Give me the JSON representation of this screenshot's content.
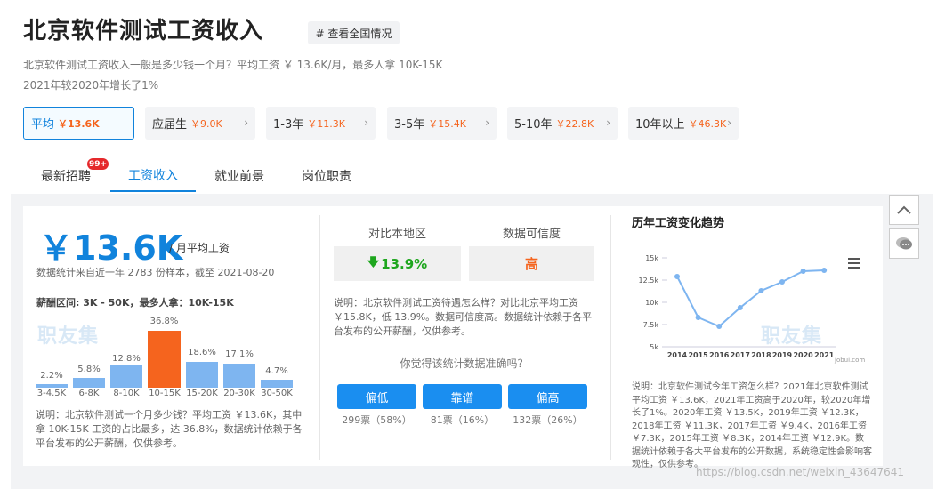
{
  "header": {
    "title": "北京软件测试工资收入",
    "tag_button": "# 查看全国情况",
    "desc_line1": "北京软件测试工资收入一般是多少钱一个月？平均工资 ￥ 13.6K/月，最多人拿 10K-15K",
    "desc_line2": "2021年较2020年增长了1%"
  },
  "levels": [
    {
      "label": "平均",
      "value": "￥13.6K",
      "active": true
    },
    {
      "label": "应届生",
      "value": "￥9.0K",
      "active": false
    },
    {
      "label": "1-3年",
      "value": "￥11.3K",
      "active": false
    },
    {
      "label": "3-5年",
      "value": "￥15.4K",
      "active": false
    },
    {
      "label": "5-10年",
      "value": "￥22.8K",
      "active": false
    },
    {
      "label": "10年以上",
      "value": "￥46.3K",
      "active": false
    }
  ],
  "tabs": [
    {
      "label": "最新招聘",
      "badge": "99+"
    },
    {
      "label": "工资收入",
      "active": true
    },
    {
      "label": "就业前景"
    },
    {
      "label": "岗位职责"
    }
  ],
  "salary": {
    "big": "￥13.6K",
    "suffix": "/ 月平均工资",
    "sample_note": "数据统计来自近一年 2783 份样本，截至 2021-08-20",
    "range_note": "薪酬区间: 3K - 50K，最多人拿：10K-15K",
    "watermark": "职友集",
    "explain": "说明：北京软件测试一个月多少钱？平均工资 ￥13.6K，其中拿 10K-15K 工资的占比最多，达 36.8%，数据统计依赖于各平台发布的公开薪酬，仅供参考。"
  },
  "dist": [
    {
      "range": "3-4.5K",
      "pct": "2.2%",
      "value": 2.2
    },
    {
      "range": "6-8K",
      "pct": "5.8%",
      "value": 5.8
    },
    {
      "range": "8-10K",
      "pct": "12.8%",
      "value": 12.8
    },
    {
      "range": "10-15K",
      "pct": "36.8%",
      "value": 36.8,
      "highlight": true
    },
    {
      "range": "15-20K",
      "pct": "18.6%",
      "value": 18.6
    },
    {
      "range": "20-30K",
      "pct": "17.1%",
      "value": 17.1
    },
    {
      "range": "30-50K",
      "pct": "4.7%",
      "value": 4.7
    }
  ],
  "compare": {
    "h1": "对比本地区",
    "h2": "数据可信度",
    "v1": "13.9%",
    "v1_arrow": "🡇",
    "v2": "高",
    "note": "说明：北京软件测试工资待遇怎么样？对比北京平均工资 ￥15.8K，低 13.9%。数据可信度高。数据统计依赖于各平台发布的公开薪酬，仅供参考。",
    "question": "你觉得该统计数据准确吗？",
    "votes": [
      {
        "label": "偏低",
        "count": "299票（58%）"
      },
      {
        "label": "靠谱",
        "count": "81票（16%）"
      },
      {
        "label": "偏高",
        "count": "132票（26%）"
      }
    ]
  },
  "trend": {
    "title": "历年工资变化趋势",
    "menu_icon": "menu-icon",
    "site": "jobui.com",
    "watermark": "职友集",
    "note": "说明：北京软件测试今年工资怎么样？2021年北京软件测试平均工资 ￥13.6K，2021年工资高于2020年，较2020年增长了1%。2020年工资 ￥13.5K，2019年工资 ￥12.3K，2018年工资 ￥11.3K，2017年工资 ￥9.4K，2016年工资 ￥7.3K，2015年工资 ￥8.3K，2014年工资 ￥12.9K。数据统计依赖于各大平台发布的公开数据，系统稳定性会影响客观性，仅供参考。"
  },
  "chart_data": {
    "type": "line",
    "x": [
      "2014",
      "2015",
      "2016",
      "2017",
      "2018",
      "2019",
      "2020",
      "2021"
    ],
    "values": [
      12.9,
      8.3,
      7.3,
      9.4,
      11.3,
      12.3,
      13.5,
      13.6
    ],
    "ylim": [
      5,
      15
    ],
    "yticks": [
      "5k",
      "7.5k",
      "10k",
      "12.5k",
      "15k"
    ],
    "color": "#7eb5f0"
  },
  "side": {
    "up_icon": "chevron-up-icon",
    "chat_icon": "chat-icon"
  },
  "watermark_url": "https://blog.csdn.net/weixin_43647641",
  "colors": {
    "accent": "#1183dc",
    "orange": "#f5641e",
    "green": "#1ea61e"
  }
}
